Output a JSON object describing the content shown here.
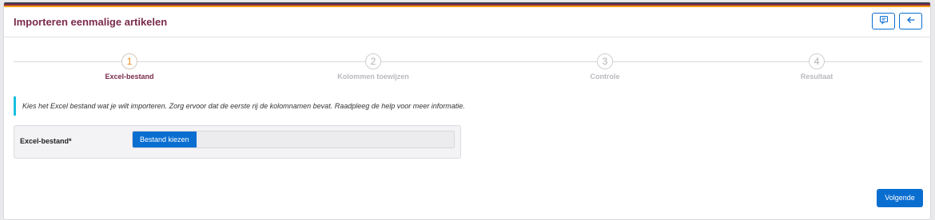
{
  "header": {
    "title": "Importeren eenmalige artikelen"
  },
  "colors": {
    "accent": "#0a6ed1",
    "title": "#7a2a4b",
    "active_step_number": "#f08a1c",
    "info_bar": "#19bfe0"
  },
  "icons": {
    "feedback": "comment-icon",
    "back": "arrow-left-icon"
  },
  "steps": [
    {
      "number": "1",
      "label": "Excel-bestand",
      "active": true
    },
    {
      "number": "2",
      "label": "Kolommen toewijzen",
      "active": false
    },
    {
      "number": "3",
      "label": "Controle",
      "active": false
    },
    {
      "number": "4",
      "label": "Resultaat",
      "active": false
    }
  ],
  "info": {
    "text": "Kies het Excel bestand wat je wilt importeren. Zorg ervoor dat de eerste rij de kolomnamen bevat. Raadpleeg de help voor meer informatie."
  },
  "form": {
    "file_label": "Excel-bestand*",
    "choose_button": "Bestand kiezen",
    "file_name": ""
  },
  "actions": {
    "next": "Volgende"
  }
}
